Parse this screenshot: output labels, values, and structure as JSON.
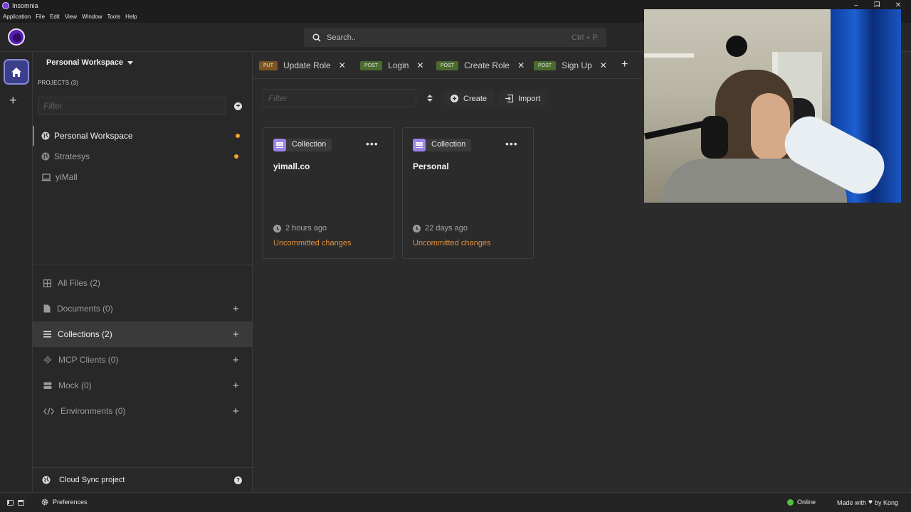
{
  "window": {
    "title": "Insomnia",
    "menu": [
      "Application",
      "File",
      "Edit",
      "View",
      "Window",
      "Tools",
      "Help"
    ],
    "controls": [
      "minimize",
      "restore",
      "close"
    ]
  },
  "header": {
    "search_placeholder": "Search..",
    "search_shortcut": "Ctrl + P"
  },
  "sidebar": {
    "workspace_label": "Personal Workspace",
    "projects_label": "PROJECTS (3)",
    "filter_placeholder": "Filter",
    "projects": [
      {
        "label": "Personal Workspace",
        "icon": "globe-icon",
        "active": true,
        "unsynced": true
      },
      {
        "label": "Stratesys",
        "icon": "globe-icon",
        "active": false,
        "unsynced": true
      },
      {
        "label": "yiMall",
        "icon": "laptop-icon",
        "active": false,
        "unsynced": false
      }
    ],
    "categories": [
      {
        "label": "All Files (2)",
        "icon": "grid-icon",
        "addable": false
      },
      {
        "label": "Documents (0)",
        "icon": "document-icon",
        "addable": true
      },
      {
        "label": "Collections (2)",
        "icon": "list-icon",
        "addable": true,
        "active": true
      },
      {
        "label": "MCP Clients (0)",
        "icon": "mcp-icon",
        "addable": true
      },
      {
        "label": "Mock (0)",
        "icon": "server-icon",
        "addable": true
      },
      {
        "label": "Environments (0)",
        "icon": "code-icon",
        "addable": true
      }
    ],
    "cloud_sync": "Cloud Sync project"
  },
  "tabs": [
    {
      "method": "PUT",
      "label": "Update Role"
    },
    {
      "method": "POST",
      "label": "Login"
    },
    {
      "method": "POST",
      "label": "Create Role"
    },
    {
      "method": "POST",
      "label": "Sign Up"
    }
  ],
  "toolbar": {
    "filter_placeholder": "Filter",
    "create_label": "Create",
    "import_label": "Import"
  },
  "cards": [
    {
      "badge": "Collection",
      "name": "yimall.co",
      "time": "2 hours ago",
      "status": "Uncommitted changes"
    },
    {
      "badge": "Collection",
      "name": "Personal",
      "time": "22 days ago",
      "status": "Uncommitted changes"
    }
  ],
  "statusbar": {
    "preferences": "Preferences",
    "online": "Online",
    "made_with": "Made with",
    "by": "by Kong"
  },
  "colors": {
    "accent": "#8c73d6",
    "put_method": "#7c5522",
    "post_method": "#4a6a2e",
    "uncommitted": "#e2913a",
    "online": "#55c040",
    "unsynced_dot": "#f0a233"
  }
}
